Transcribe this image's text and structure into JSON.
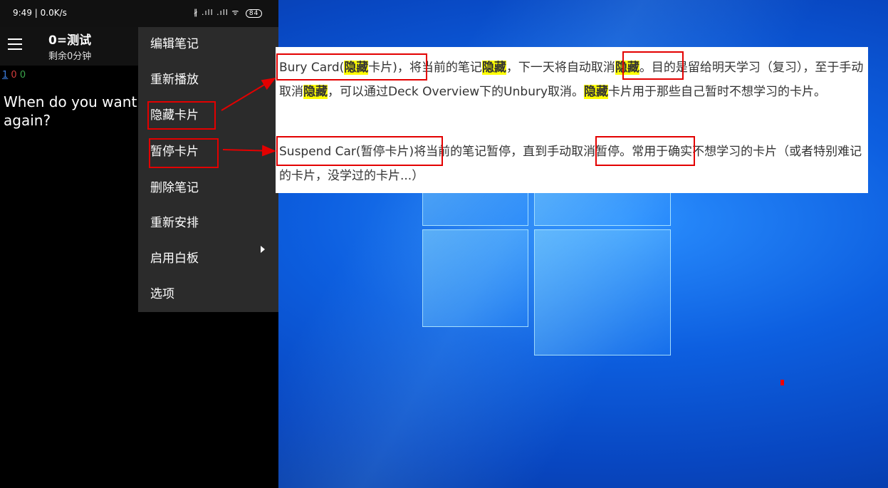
{
  "phone": {
    "status_time": "9:49 | 0.0K/s",
    "status_icons": "∦ .ıll .ıll ᯤ",
    "battery": "84",
    "title": "0=测试",
    "subtitle": "剩余0分钟",
    "counts": {
      "new": "1",
      "learning": "0",
      "review": "0"
    },
    "question": "When do you want\nagain?"
  },
  "menu": {
    "items": [
      "编辑笔记",
      "重新播放",
      "隐藏卡片",
      "暂停卡片",
      "删除笔记",
      "重新安排",
      "启用白板",
      "选项"
    ]
  },
  "note": {
    "bury": {
      "label": "Bury Card(",
      "hl1": "隐藏",
      "label_end": "卡片)，",
      "t1": "将当前的笔记",
      "hl2": "隐藏",
      "t2": "，下一天将",
      "boxed": "自动取消",
      "hl3": "隐藏",
      "t3": "。目的是留给明天学习（复习），至于手动取消",
      "hl4": "隐藏",
      "t4": "，可以通过Deck Overview下的Unbury取消。",
      "hl5": "隐藏",
      "t5": "卡片用于那些自己暂时不想学习的卡片。"
    },
    "suspend": {
      "label": "Suspend Car(暂停卡片)",
      "t1": "将当前的笔记暂停，直到",
      "boxed": "手动取消暂停。",
      "t2": "常用于确实不想学习的卡片（或者特别难记的卡片，没学过的卡片...）"
    }
  },
  "colors": {
    "highlight": "#ffff00",
    "annotation_red": "#e30000",
    "desktop_blue": "#0a55d8"
  }
}
